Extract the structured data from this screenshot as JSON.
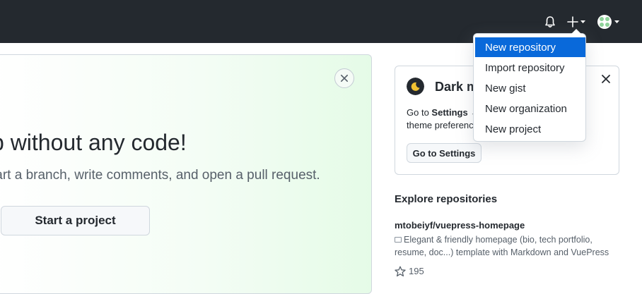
{
  "header": {
    "notifications_icon": "bell-icon",
    "create_icon": "plus-icon",
    "avatar_icon": "avatar"
  },
  "create_menu": {
    "items": [
      {
        "label": "New repository",
        "active": true
      },
      {
        "label": "Import repository",
        "active": false
      },
      {
        "label": "New gist",
        "active": false
      },
      {
        "label": "New organization",
        "active": false
      },
      {
        "label": "New project",
        "active": false
      }
    ]
  },
  "hero": {
    "title": "p without any code!",
    "subtitle": "tart a branch, write comments, and open a pull request.",
    "cta_label": "Start a project"
  },
  "dark_mode_card": {
    "title": "Dark m",
    "line1_prefix": "Go to ",
    "line1_bold": "Settings",
    "line1_suffix": " →",
    "line2": "theme preference",
    "button_label": "Go to Settings"
  },
  "explore": {
    "title": "Explore repositories",
    "repos": [
      {
        "name": "mtobeiyf/vuepress-homepage",
        "description": "Elegant & friendly homepage (bio, tech portfolio, resume, doc...) template with Markdown and VuePress",
        "stars": "195"
      }
    ]
  },
  "colors": {
    "header_bg": "#24292f",
    "menu_active_bg": "#0969da",
    "hero_gradient_end": "#e5fbe7"
  }
}
